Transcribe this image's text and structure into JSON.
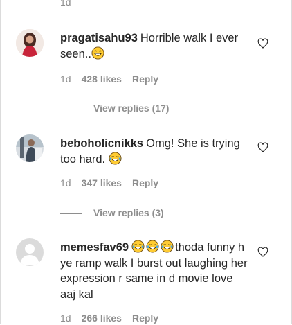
{
  "top_partial_timestamp": "1d",
  "comments": [
    {
      "username": "pragatisahu93",
      "text": "Horrible walk I ever seen..",
      "emoji": "grinning-face-with-smiling-eyes",
      "time": "1d",
      "likes": "428 likes",
      "reply_label": "Reply",
      "view_replies": "View replies (17)"
    },
    {
      "username": "beboholicnikks",
      "text": "Omg! She is trying too hard.",
      "emoji": "face-with-tears-of-joy",
      "time": "1d",
      "likes": "347 likes",
      "reply_label": "Reply",
      "view_replies": "View replies (3)"
    },
    {
      "username": "memesfav69",
      "emojis": [
        "face-with-tears-of-joy",
        "face-with-tears-of-joy",
        "face-with-tears-of-joy"
      ],
      "text": "thoda funny h ye ramp walk I burst out laughing her expression r same in d movie love aaj kal",
      "time": "1d",
      "likes": "266 likes",
      "reply_label": "Reply"
    }
  ],
  "colors": {
    "text": "#262626",
    "secondary": "#8e8e8e",
    "emoji_yellow": "#ffcc33"
  },
  "icons": {
    "like": "heart-outline-icon"
  }
}
